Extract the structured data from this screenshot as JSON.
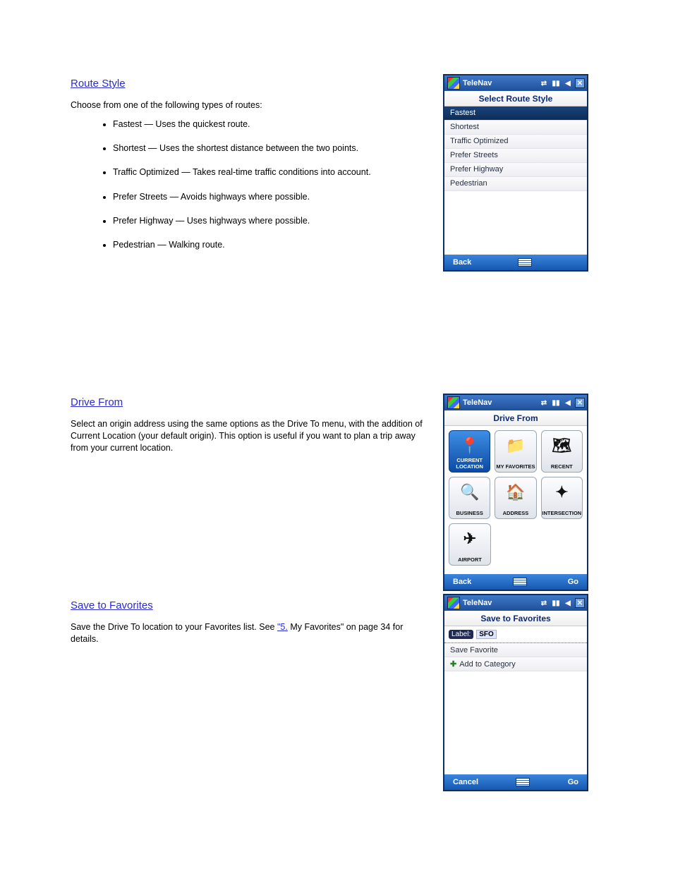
{
  "sections": {
    "route_style": {
      "heading": "Route Style",
      "intro": "Choose from one of the following types of routes:",
      "items": [
        "Fastest — Uses the quickest route.",
        "Shortest — Uses the shortest distance between the two points.",
        "Traffic Optimized — Takes real-time traffic conditions into account.",
        "Prefer Streets — Avoids highways where possible.",
        "Prefer Highway — Uses highways where possible.",
        "Pedestrian — Walking route."
      ]
    },
    "drive_from": {
      "heading": "Drive From",
      "body": "Select an origin address using the same options as the Drive To menu, with the addition of Current Location (your default origin). This option is useful if you want to plan a trip away from your current location."
    },
    "save_to_fav": {
      "heading": "Save to Favorites",
      "body_pre": "Save the Drive To location to your Favorites list. See ",
      "link": "\"5.",
      "body_post": " My Favorites\" on page 34 for details."
    }
  },
  "device1": {
    "titlebar": "TeleNav",
    "subhead": "Select Route Style",
    "options": [
      "Fastest",
      "Shortest",
      "Traffic Optimized",
      "Prefer Streets",
      "Prefer Highway",
      "Pedestrian"
    ],
    "soft_left": "Back"
  },
  "device2": {
    "titlebar": "TeleNav",
    "subhead": "Drive From",
    "tiles": [
      {
        "label": "CURRENT LOCATION",
        "glyph": "📍",
        "sel": true
      },
      {
        "label": "MY FAVORITES",
        "glyph": "📁"
      },
      {
        "label": "RECENT",
        "glyph": "🗺"
      },
      {
        "label": "BUSINESS",
        "glyph": "🔍"
      },
      {
        "label": "ADDRESS",
        "glyph": "🏠"
      },
      {
        "label": "INTERSECTION",
        "glyph": "✦"
      },
      {
        "label": "AIRPORT",
        "glyph": "✈"
      }
    ],
    "soft_left": "Back",
    "soft_right": "Go"
  },
  "device3": {
    "titlebar": "TeleNav",
    "subhead": "Save to Favorites",
    "label_caption": "Label:",
    "label_value": "SFO",
    "items": [
      "Save Favorite",
      "Add to Category"
    ],
    "soft_left": "Cancel",
    "soft_right": "Go"
  }
}
